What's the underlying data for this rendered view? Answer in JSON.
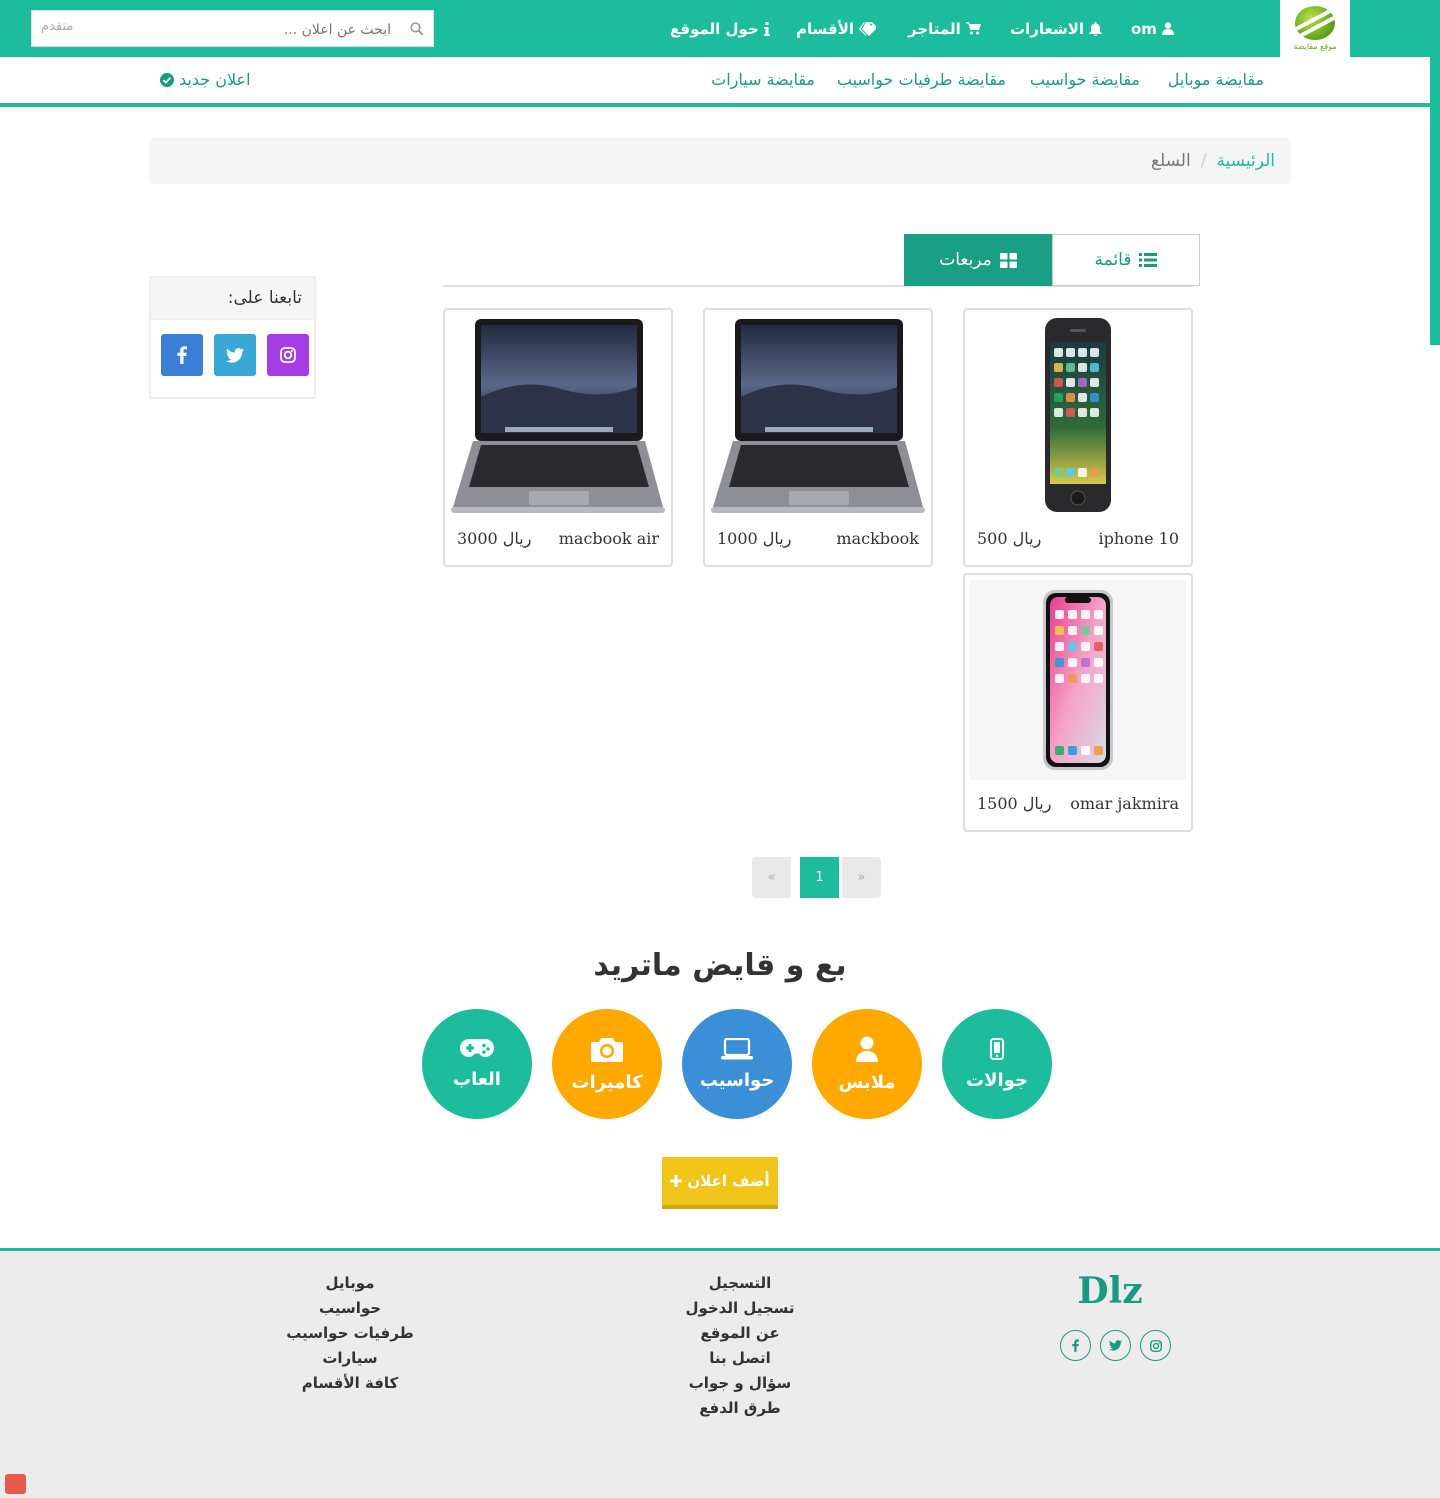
{
  "topbar": {
    "logo_caption": "موقع مقايضة",
    "user": "om",
    "nav": [
      "الاشعارات",
      "المتاجر",
      "الأقسام",
      "حول الموقع"
    ],
    "search_placeholder": "ابحث عن اعلان ...",
    "search_advanced": "متقدم"
  },
  "subnav": {
    "links": [
      "مقايضة موبايل",
      "مقايضة حواسيب",
      "مقايضة طرفيات حواسيب",
      "مقايضة سيارات"
    ],
    "new_ad": "اعلان جديد"
  },
  "breadcrumb": {
    "home": "الرئيسية",
    "sep": "/",
    "current": "السلع"
  },
  "view_toggle": {
    "list": "قائمة",
    "grid": "مربعات",
    "active": "grid"
  },
  "products": [
    {
      "name": "iphone 10",
      "price": "ريال 500",
      "image": "phone-image"
    },
    {
      "name": "mackbook",
      "price": "ريال 1000",
      "image": "laptop-image"
    },
    {
      "name": "macbook air",
      "price": "ريال 3000",
      "image": "laptop-image"
    },
    {
      "name": "omar jakmira",
      "price": "ريال 1500",
      "image": "phone-x-image"
    }
  ],
  "follow": {
    "title": "تابعنا على:",
    "networks": [
      "instagram",
      "twitter",
      "facebook"
    ]
  },
  "pagination": {
    "prev": "«",
    "current": "1",
    "next": "»"
  },
  "promo": {
    "title": "بع و قايض ماتريد",
    "categories": [
      {
        "label": "جوالات",
        "icon": "mobile-icon",
        "color": "#1dbc9c"
      },
      {
        "label": "ملابس",
        "icon": "user-icon",
        "color": "#ffa800"
      },
      {
        "label": "حواسيب",
        "icon": "laptop-icon",
        "color": "#3b8fd6"
      },
      {
        "label": "كاميرات",
        "icon": "camera-icon",
        "color": "#ffa800"
      },
      {
        "label": "العاب",
        "icon": "gamepad-icon",
        "color": "#1dbc9c"
      }
    ],
    "add_button": "أضف اعلان"
  },
  "footer": {
    "brand": "Dlz",
    "col_links": [
      "التسجيل",
      "تسجيل الدخول",
      "عن الموقع",
      "اتصل بنا",
      "سؤال و جواب",
      "طرق الدفع"
    ],
    "col_categories": [
      "موبايل",
      "حواسيب",
      "طرفيات حواسيب",
      "سيارات",
      "كافة الأقسام"
    ]
  },
  "colors": {
    "accent": "#1dbc9c",
    "accent_dark": "#1a9e84",
    "yellow": "#f0c419"
  }
}
